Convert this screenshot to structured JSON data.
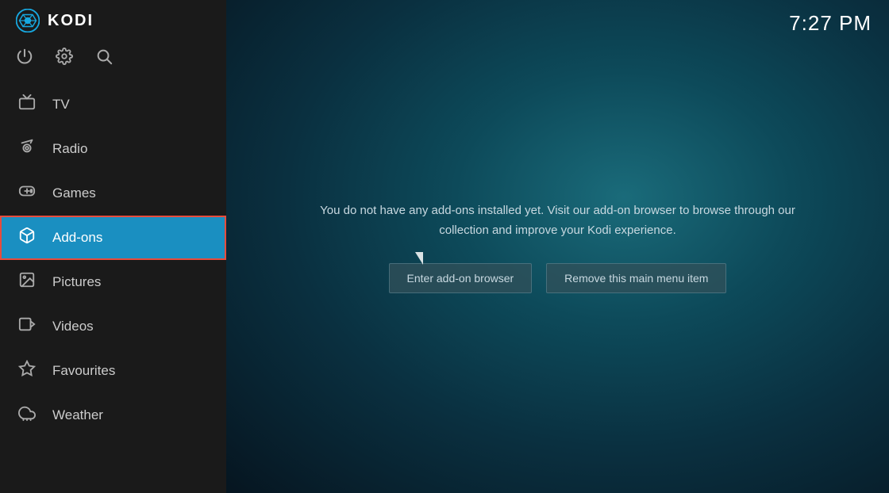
{
  "app": {
    "title": "KODI",
    "clock": "7:27 PM"
  },
  "sidebar": {
    "icons": [
      {
        "name": "power-icon",
        "symbol": "⏻"
      },
      {
        "name": "settings-icon",
        "symbol": "⚙"
      },
      {
        "name": "search-icon",
        "symbol": "🔍"
      }
    ],
    "nav_items": [
      {
        "id": "tv",
        "label": "TV",
        "icon": "tv",
        "active": false
      },
      {
        "id": "radio",
        "label": "Radio",
        "icon": "radio",
        "active": false
      },
      {
        "id": "games",
        "label": "Games",
        "icon": "games",
        "active": false
      },
      {
        "id": "addons",
        "label": "Add-ons",
        "icon": "addons",
        "active": true
      },
      {
        "id": "pictures",
        "label": "Pictures",
        "icon": "pictures",
        "active": false
      },
      {
        "id": "videos",
        "label": "Videos",
        "icon": "videos",
        "active": false
      },
      {
        "id": "favourites",
        "label": "Favourites",
        "icon": "favourites",
        "active": false
      },
      {
        "id": "weather",
        "label": "Weather",
        "icon": "weather",
        "active": false
      }
    ]
  },
  "main": {
    "message": "You do not have any add-ons installed yet. Visit our add-on browser to browse through our collection and improve your Kodi experience.",
    "buttons": [
      {
        "id": "enter-addon-browser",
        "label": "Enter add-on browser"
      },
      {
        "id": "remove-menu-item",
        "label": "Remove this main menu item"
      }
    ]
  }
}
